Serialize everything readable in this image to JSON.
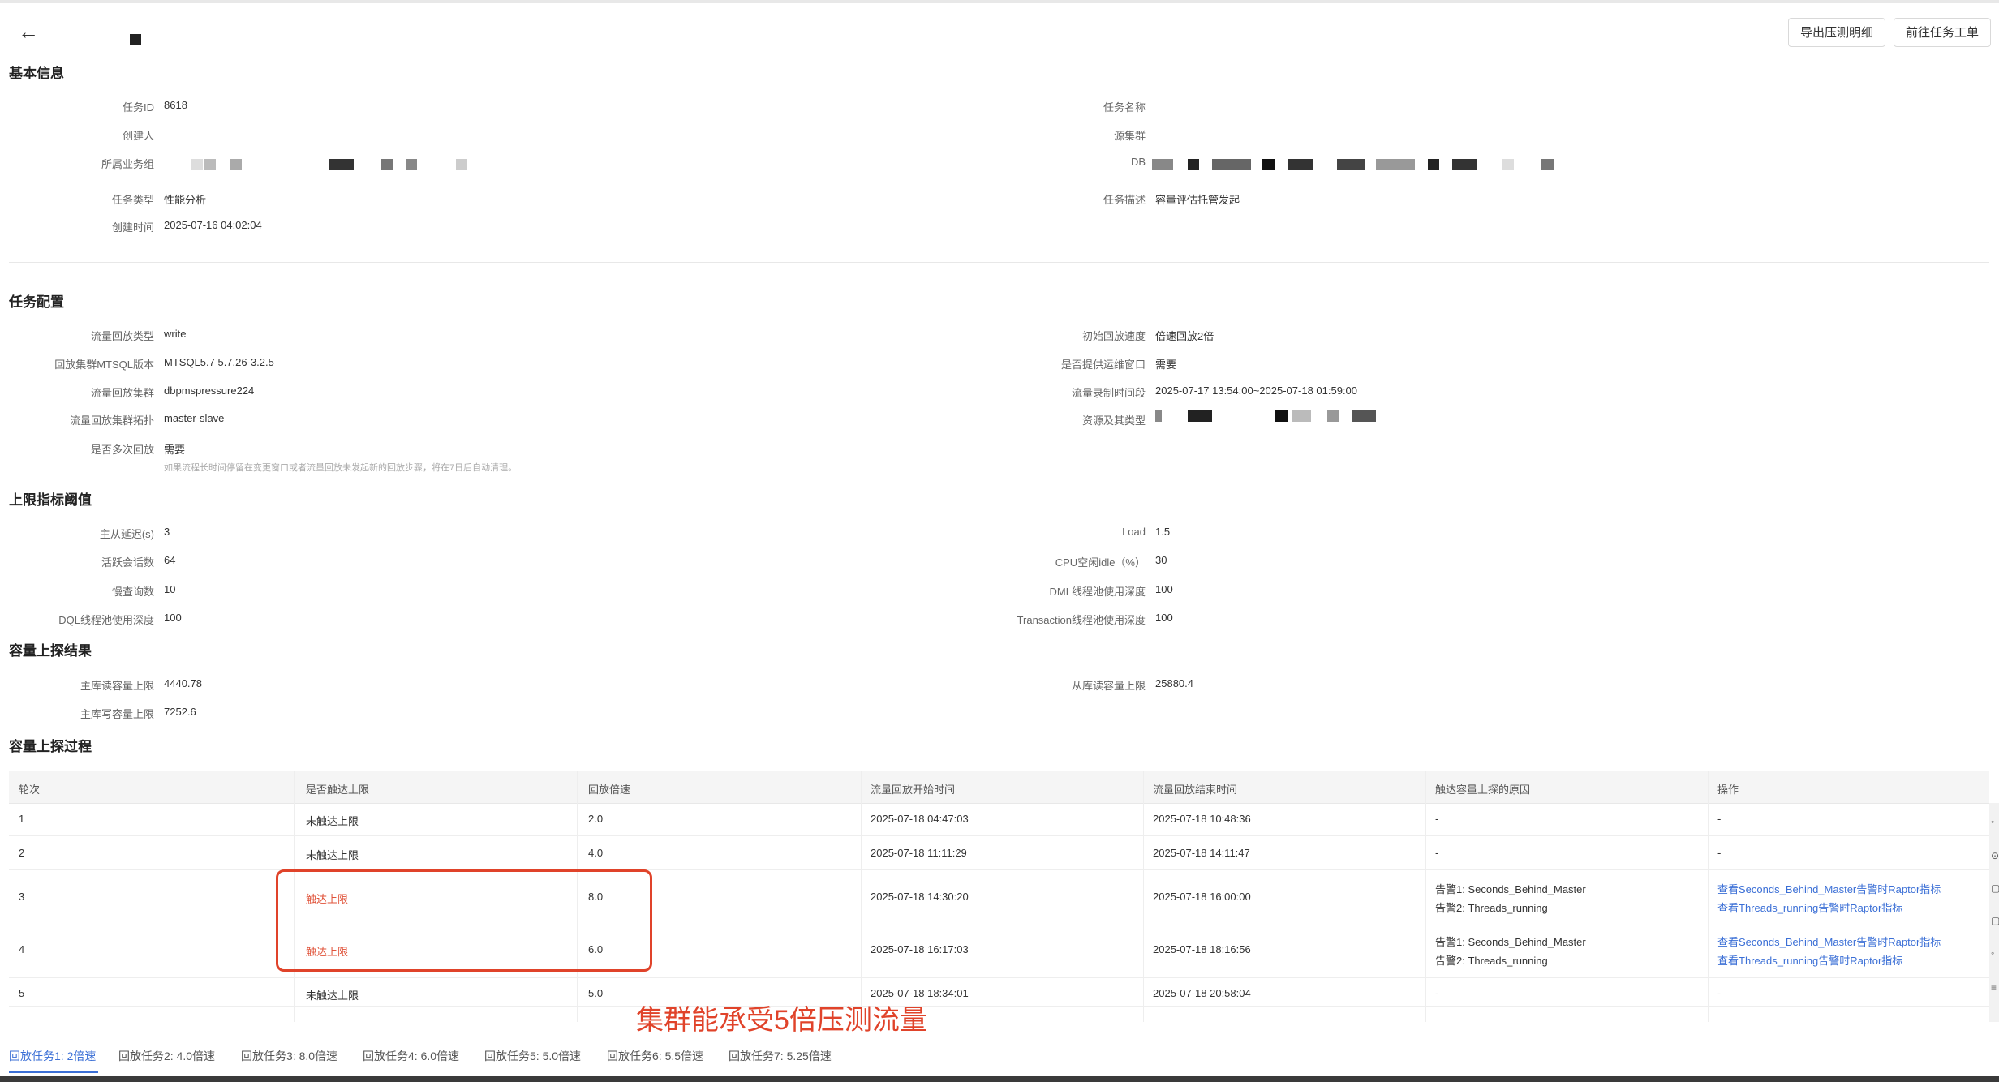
{
  "header": {
    "back_icon": "arrow-left-icon",
    "export_button": "导出压测明细",
    "goto_ticket_button": "前往任务工单"
  },
  "basic_info": {
    "title": "基本信息",
    "task_id_label": "任务ID",
    "task_id": "8618",
    "task_name_label": "任务名称",
    "creator_label": "创建人",
    "source_cluster_label": "源集群",
    "biz_group_label": "所属业务组",
    "db_label": "DB",
    "task_type_label": "任务类型",
    "task_type": "性能分析",
    "task_desc_label": "任务描述",
    "task_desc": "容量评估托管发起",
    "created_at_label": "创建时间",
    "created_at": "2025-07-16 04:02:04"
  },
  "task_config": {
    "title": "任务配置",
    "replay_type_label": "流量回放类型",
    "replay_type": "write",
    "init_speed_label": "初始回放速度",
    "init_speed": "倍速回放2倍",
    "mtsql_version_label": "回放集群MTSQL版本",
    "mtsql_version": "MTSQL5.7 5.7.26-3.2.5",
    "ops_window_label": "是否提供运维窗口",
    "ops_window": "需要",
    "replay_cluster_label": "流量回放集群",
    "replay_cluster": "dbpmspressure224",
    "record_period_label": "流量录制时间段",
    "record_period": "2025-07-17 13:54:00~2025-07-18 01:59:00",
    "topology_label": "流量回放集群拓扑",
    "topology": "master-slave",
    "resource_label": "资源及其类型",
    "multi_replay_label": "是否多次回放",
    "multi_replay": "需要",
    "multi_replay_note": "如果流程长时间停留在变更窗口或者流量回放未发起新的回放步骤，将在7日后自动清理。"
  },
  "thresholds": {
    "title": "上限指标阈值",
    "delay_label": "主从延迟(s)",
    "delay": "3",
    "load_label": "Load",
    "load": "1.5",
    "sessions_label": "活跃会话数",
    "sessions": "64",
    "cpu_label": "CPU空闲idle（%）",
    "cpu": "30",
    "slow_label": "慢查询数",
    "slow": "10",
    "dml_label": "DML线程池使用深度",
    "dml": "100",
    "dql_label": "DQL线程池使用深度",
    "dql": "100",
    "trx_label": "Transaction线程池使用深度",
    "trx": "100"
  },
  "capacity_result": {
    "title": "容量上探结果",
    "master_read_label": "主库读容量上限",
    "master_read": "4440.78",
    "slave_read_label": "从库读容量上限",
    "slave_read": "25880.4",
    "master_write_label": "主库写容量上限",
    "master_write": "7252.6"
  },
  "process": {
    "title": "容量上探过程",
    "columns": [
      "轮次",
      "是否触达上限",
      "回放倍速",
      "流量回放开始时间",
      "流量回放结束时间",
      "触达容量上探的原因",
      "操作"
    ],
    "rows": [
      {
        "round": "1",
        "reached": "未触达上限",
        "speed": "2.0",
        "start": "2025-07-18 04:47:03",
        "end": "2025-07-18 10:48:36",
        "reason1": "-",
        "reason2": "",
        "op1": "-",
        "op2": ""
      },
      {
        "round": "2",
        "reached": "未触达上限",
        "speed": "4.0",
        "start": "2025-07-18 11:11:29",
        "end": "2025-07-18 14:11:47",
        "reason1": "-",
        "reason2": "",
        "op1": "-",
        "op2": ""
      },
      {
        "round": "3",
        "reached": "触达上限",
        "speed": "8.0",
        "start": "2025-07-18 14:30:20",
        "end": "2025-07-18 16:00:00",
        "reason1": "告警1:  Seconds_Behind_Master",
        "reason2": "告警2:  Threads_running",
        "op1": "查看Seconds_Behind_Master告警时Raptor指标",
        "op2": "查看Threads_running告警时Raptor指标"
      },
      {
        "round": "4",
        "reached": "触达上限",
        "speed": "6.0",
        "start": "2025-07-18 16:17:03",
        "end": "2025-07-18 18:16:56",
        "reason1": "告警1:  Seconds_Behind_Master",
        "reason2": "告警2:  Threads_running",
        "op1": "查看Seconds_Behind_Master告警时Raptor指标",
        "op2": "查看Threads_running告警时Raptor指标"
      },
      {
        "round": "5",
        "reached": "未触达上限",
        "speed": "5.0",
        "start": "2025-07-18 18:34:01",
        "end": "2025-07-18 20:58:04",
        "reason1": "-",
        "reason2": "",
        "op1": "-",
        "op2": ""
      }
    ]
  },
  "annotation": {
    "text": "集群能承受5倍压测流量",
    "color": "#e0432a"
  },
  "tabs": [
    "回放任务1: 2倍速",
    "回放任务2: 4.0倍速",
    "回放任务3: 8.0倍速",
    "回放任务4: 6.0倍速",
    "回放任务5: 5.0倍速",
    "回放任务6: 5.5倍速",
    "回放任务7: 5.25倍速"
  ],
  "colors": {
    "link": "#3b6fd6",
    "danger": "#e0533a"
  }
}
